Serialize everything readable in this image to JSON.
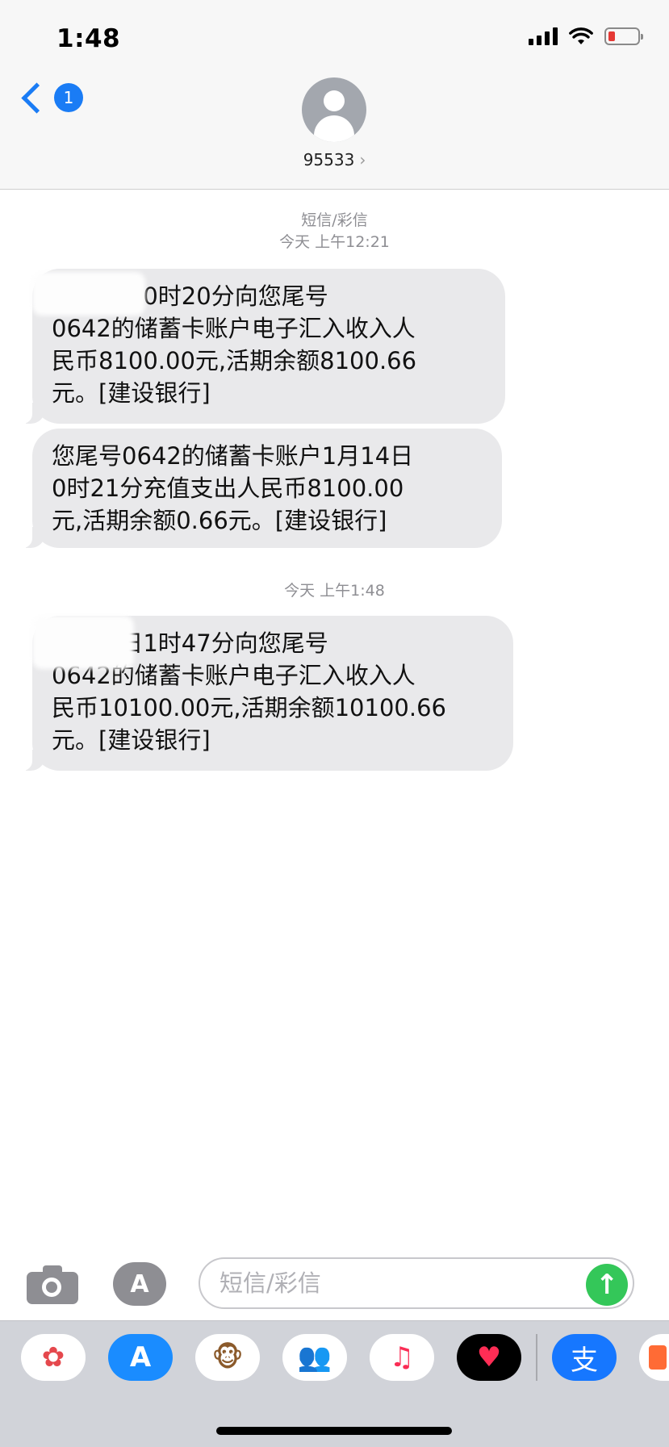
{
  "status_bar": {
    "time": "1:48"
  },
  "header": {
    "back_badge": "1",
    "contact_name": "95533",
    "contact_chevron": "›"
  },
  "conversation": {
    "channel_label": "短信/彩信",
    "groups": [
      {
        "time_label": "今天 上午12:21"
      },
      {
        "time_label": "今天 上午1:48"
      }
    ],
    "messages": [
      {
        "text": "1月14日0时20分向您尾号\n0642的储蓄卡账户电子汇入收入人\n民币8100.00元,活期余额8100.66\n元。[建设银行]"
      },
      {
        "text": "您尾号0642的储蓄卡账户1月14日\n0时21分充值支出人民币8100.00\n元,活期余额0.66元。[建设银行]"
      },
      {
        "text": "1月14日1时47分向您尾号\n0642的储蓄卡账户电子汇入收入人\n民币10100.00元,活期余额10100.66\n元。[建设银行]"
      }
    ]
  },
  "compose": {
    "placeholder": "短信/彩信",
    "apps_glyph": "A",
    "send_glyph": "↑"
  },
  "drawer": {
    "apps": [
      {
        "name": "photos-icon",
        "glyph": "✿",
        "color": "#e5484d"
      },
      {
        "name": "app-store-icon",
        "glyph": "A",
        "color": "#1a8cff"
      },
      {
        "name": "animoji-monkey-icon",
        "glyph": "🐵",
        "color": "#8b5a2b"
      },
      {
        "name": "memoji-icon",
        "glyph": "👥",
        "color": "#6d4c41"
      },
      {
        "name": "music-icon",
        "glyph": "♫",
        "color": "#fa2d55"
      },
      {
        "name": "digital-touch-icon",
        "glyph": "♥",
        "color": "#ff2d55"
      },
      {
        "name": "alipay-icon",
        "glyph": "支",
        "color": "#1677ff"
      },
      {
        "name": "partial-app-icon",
        "glyph": "",
        "color": "#ff6b35"
      }
    ]
  },
  "colors": {
    "accent": "#1a7cf5",
    "bubble": "#e9e9eb",
    "send": "#34c759"
  }
}
